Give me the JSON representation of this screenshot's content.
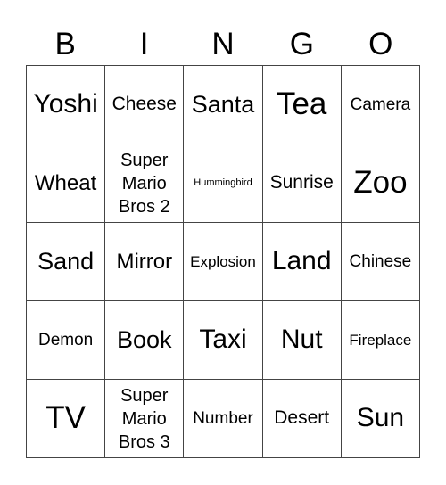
{
  "header": [
    "B",
    "I",
    "N",
    "G",
    "O"
  ],
  "cells": [
    [
      "Yoshi",
      "Cheese",
      "Santa",
      "Tea",
      "Camera"
    ],
    [
      "Wheat",
      "Super Mario Bros 2",
      "Hummingbird",
      "Sunrise",
      "Zoo"
    ],
    [
      "Sand",
      "Mirror",
      "Explosion",
      "Land",
      "Chinese"
    ],
    [
      "Demon",
      "Book",
      "Taxi",
      "Nut",
      "Fireplace"
    ],
    [
      "TV",
      "Super Mario Bros 3",
      "Number",
      "Desert",
      "Sun"
    ]
  ]
}
